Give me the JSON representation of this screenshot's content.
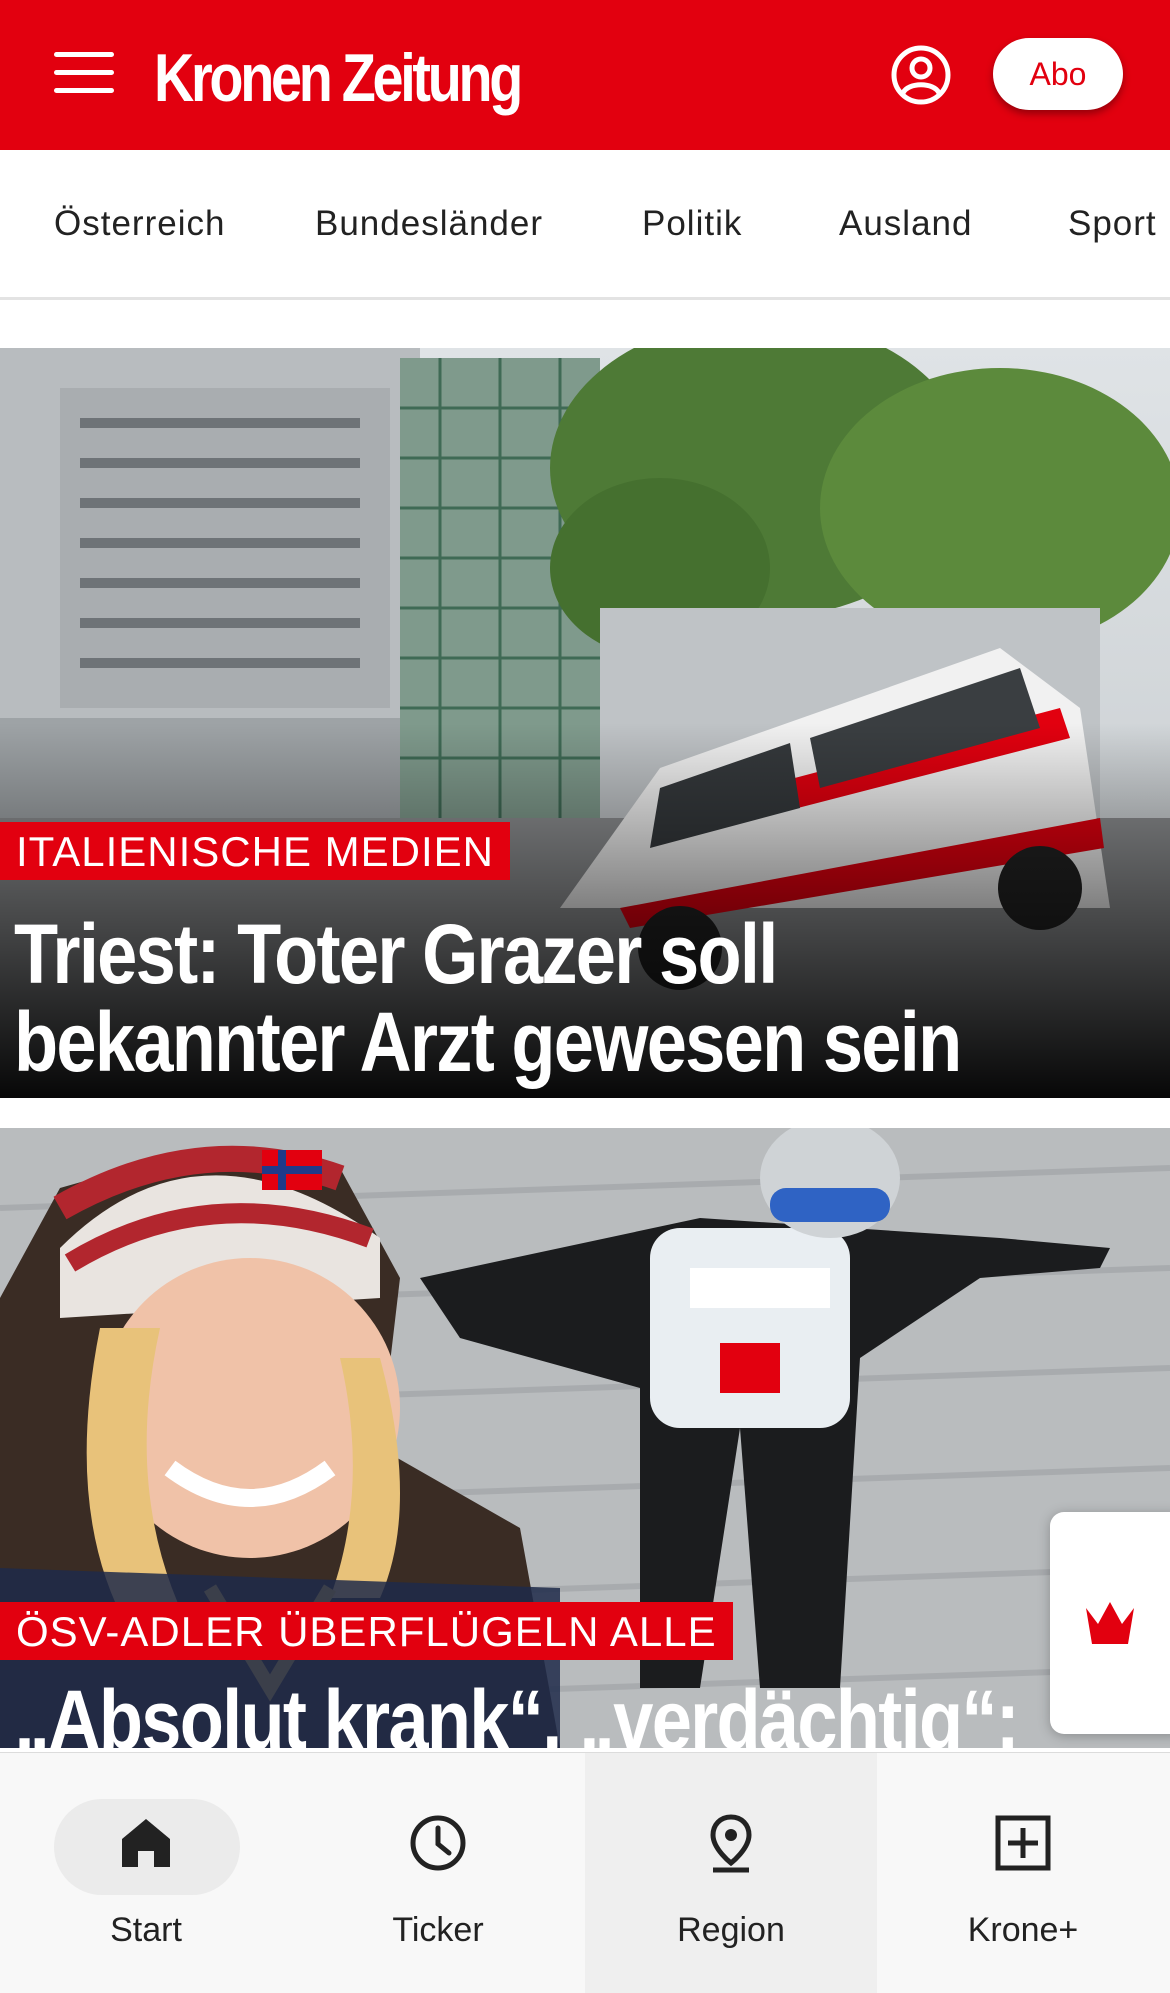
{
  "header": {
    "logo": "Kronen Zeitung",
    "abo_label": "Abo",
    "menu_icon": "hamburger-menu-icon",
    "account_icon": "user-account-icon"
  },
  "categories": [
    "Österreich",
    "Bundesländer",
    "Politik",
    "Ausland",
    "Sport"
  ],
  "articles": [
    {
      "kicker": "ITALIENISCHE MEDIEN",
      "headline_line1": "Triest: Toter Grazer soll",
      "headline_line2": "bekannter Arzt gewesen sein"
    },
    {
      "kicker": "ÖSV-ADLER ÜBERFLÜGELN ALLE",
      "headline_line1": "„Absolut krank“, „verdächtig“:"
    }
  ],
  "bottom_nav": [
    {
      "label": "Start",
      "icon": "home-icon",
      "active": true
    },
    {
      "label": "Ticker",
      "icon": "clock-icon"
    },
    {
      "label": "Region",
      "icon": "location-pin-icon"
    },
    {
      "label": "Krone+",
      "icon": "plus-box-icon"
    }
  ],
  "colors": {
    "brand_red": "#e2000f",
    "text_dark": "#222222",
    "nav_background": "#f8f8f8"
  }
}
